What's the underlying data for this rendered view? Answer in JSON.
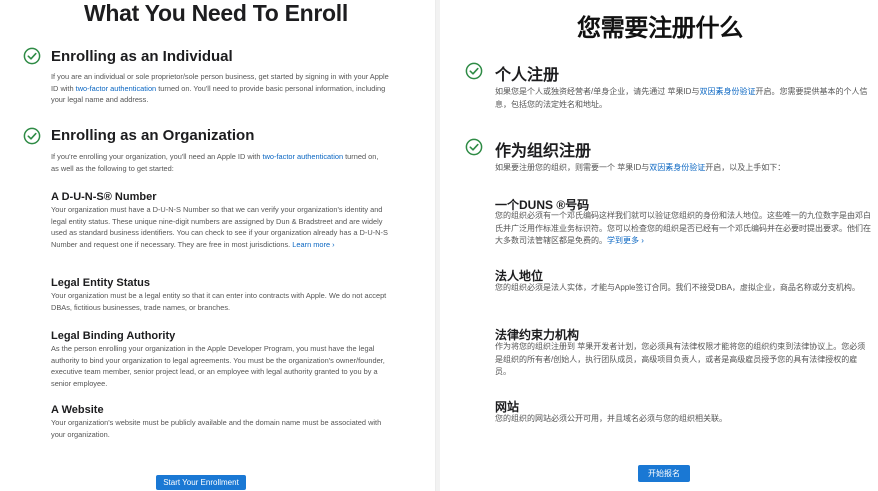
{
  "english": {
    "title": "What You Need To Enroll",
    "individual": {
      "heading": "Enrolling as an Individual",
      "text_before": "If you are an individual or sole proprietor/sole person business, get started by signing in with your Apple ID with ",
      "link": "two-factor authentication",
      "text_after": " turned on. You'll need to provide basic personal information, including your legal name and address."
    },
    "organization": {
      "heading": "Enrolling as an Organization",
      "text_before": "If you're enrolling your organization, you'll need an Apple ID with ",
      "link": "two-factor authentication",
      "text_after": " turned on, as well as the following to get started:"
    },
    "duns": {
      "heading": "A D-U-N-S® Number",
      "text": "Your organization must have a D-U-N-S Number so that we can verify your organization's identity and legal entity status. These unique nine-digit numbers are assigned by Dun & Bradstreet and are widely used as standard business identifiers. You can check to see if your organization already has a D-U-N-S Number and request one if necessary. They are free in most jurisdictions. ",
      "link": "Learn more ›"
    },
    "legal_entity": {
      "heading": "Legal Entity Status",
      "text": "Your organization must be a legal entity so that it can enter into contracts with Apple. We do not accept DBAs, fictitious businesses, trade names, or branches."
    },
    "binding": {
      "heading": "Legal Binding Authority",
      "text": "As the person enrolling your organization in the Apple Developer Program, you must have the legal authority to bind your organization to legal agreements. You must be the organization's owner/founder, executive team member, senior project lead, or an employee with legal authority granted to you by a senior employee."
    },
    "website": {
      "heading": "A Website",
      "text": "Your organization's website must be publicly available and the domain name must be associated with your organization."
    },
    "button": "Start Your Enrollment"
  },
  "chinese": {
    "title": "您需要注册什么",
    "individual": {
      "heading": "个人注册",
      "text_before": "如果您是个人或独资经营者/单身企业，请先通过 苹果ID与",
      "link": "双因素身份验证",
      "text_after": "开启。您需要提供基本的个人信息，包括您的法定姓名和地址。"
    },
    "organization": {
      "heading": "作为组织注册",
      "text_before": "如果要注册您的组织，则需要一个 苹果ID与",
      "link": "双因素身份验证",
      "text_after": "开启，以及上手如下："
    },
    "duns": {
      "heading": "一个DUNS ®号码",
      "text": "您的组织必须有一个邓氏编码这样我们就可以验证您组织的身份和法人地位。这些唯一的九位数字是由邓白氏并广泛用作标准业务标识符。您可以检查您的组织是否已经有一个邓氏编码并在必要时提出要求。他们在大多数司法管辖区都是免费的。",
      "link": "学到更多 ›"
    },
    "legal_entity": {
      "heading": "法人地位",
      "text": "您的组织必须是法人实体，才能与Apple签订合同。我们不接受DBA，虚拟企业，商品名称或分支机构。"
    },
    "binding": {
      "heading": "法律约束力机构",
      "text": "作为将您的组织注册到 苹果开发者计划，您必须具有法律权限才能将您的组织约束到法律协议上。您必须是组织的所有者/创始人，执行团队成员，高级项目负责人，或者是高级雇员授予您的具有法律授权的雇员。"
    },
    "website": {
      "heading": "网站",
      "text": "您的组织的网站必须公开可用，并且域名必须与您的组织相关联。"
    },
    "button": "开始报名"
  },
  "colors": {
    "check_green": "#2e8b45",
    "link_blue": "#0a66c2",
    "button_blue": "#1a78d4"
  },
  "icons": [
    "checkmark-circle-icon"
  ]
}
